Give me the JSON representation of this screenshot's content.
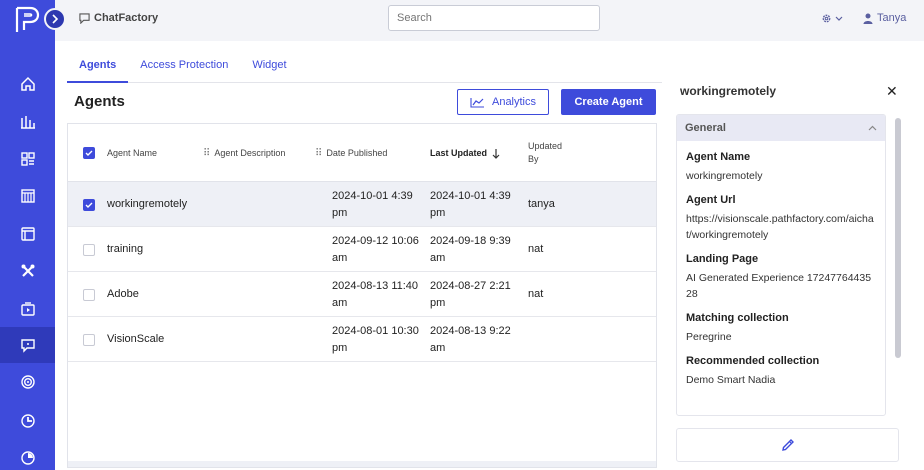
{
  "app": {
    "name": "ChatFactory"
  },
  "search": {
    "placeholder": "Search"
  },
  "user": {
    "name": "Tanya"
  },
  "tabs": [
    {
      "label": "Agents",
      "active": true
    },
    {
      "label": "Access Protection",
      "active": false
    },
    {
      "label": "Widget",
      "active": false
    }
  ],
  "page": {
    "title": "Agents"
  },
  "buttons": {
    "analytics": "Analytics",
    "create": "Create Agent"
  },
  "table": {
    "headers": {
      "name": "Agent Name",
      "description": "Agent Description",
      "published": "Date Published",
      "updated": "Last Updated",
      "updated_by": "Updated By"
    },
    "rows": [
      {
        "name": "workingremotely",
        "description": "",
        "published": "2024-10-01 4:39 pm",
        "updated": "2024-10-01 4:39 pm",
        "updated_by": "tanya",
        "checked": true
      },
      {
        "name": "training",
        "description": "",
        "published": "2024-09-12 10:06 am",
        "updated": "2024-09-18 9:39 am",
        "updated_by": "nat",
        "checked": false
      },
      {
        "name": "Adobe",
        "description": "",
        "published": "2024-08-13 11:40 am",
        "updated": "2024-08-27 2:21 pm",
        "updated_by": "nat",
        "checked": false
      },
      {
        "name": "VisionScale",
        "description": "",
        "published": "2024-08-01 10:30 pm",
        "updated": "2024-08-13 9:22 am",
        "updated_by": "",
        "checked": false
      }
    ]
  },
  "detail": {
    "title": "workingremotely",
    "section": "General",
    "fields": [
      {
        "label": "Agent Name",
        "value": "workingremotely"
      },
      {
        "label": "Agent Url",
        "value": "https://visionscale.pathfactory.com/aichat/workingremotely"
      },
      {
        "label": "Landing Page",
        "value": "AI Generated Experience 1724776443528"
      },
      {
        "label": "Matching collection",
        "value": "Peregrine"
      },
      {
        "label": "Recommended collection",
        "value": "Demo Smart Nadia"
      }
    ]
  },
  "nav": [
    {
      "icon": "home-icon"
    },
    {
      "icon": "analytics-icon"
    },
    {
      "icon": "dashboard-icon"
    },
    {
      "icon": "library-icon"
    },
    {
      "icon": "page-icon"
    },
    {
      "icon": "tools-icon"
    },
    {
      "icon": "video-icon"
    },
    {
      "icon": "chat-icon",
      "active": true
    },
    {
      "icon": "target-icon"
    },
    {
      "icon": "campaign-icon"
    },
    {
      "icon": "settings-icon"
    }
  ],
  "colors": {
    "primary": "#3e4bdb",
    "sidebar": "#3e4bdb"
  }
}
